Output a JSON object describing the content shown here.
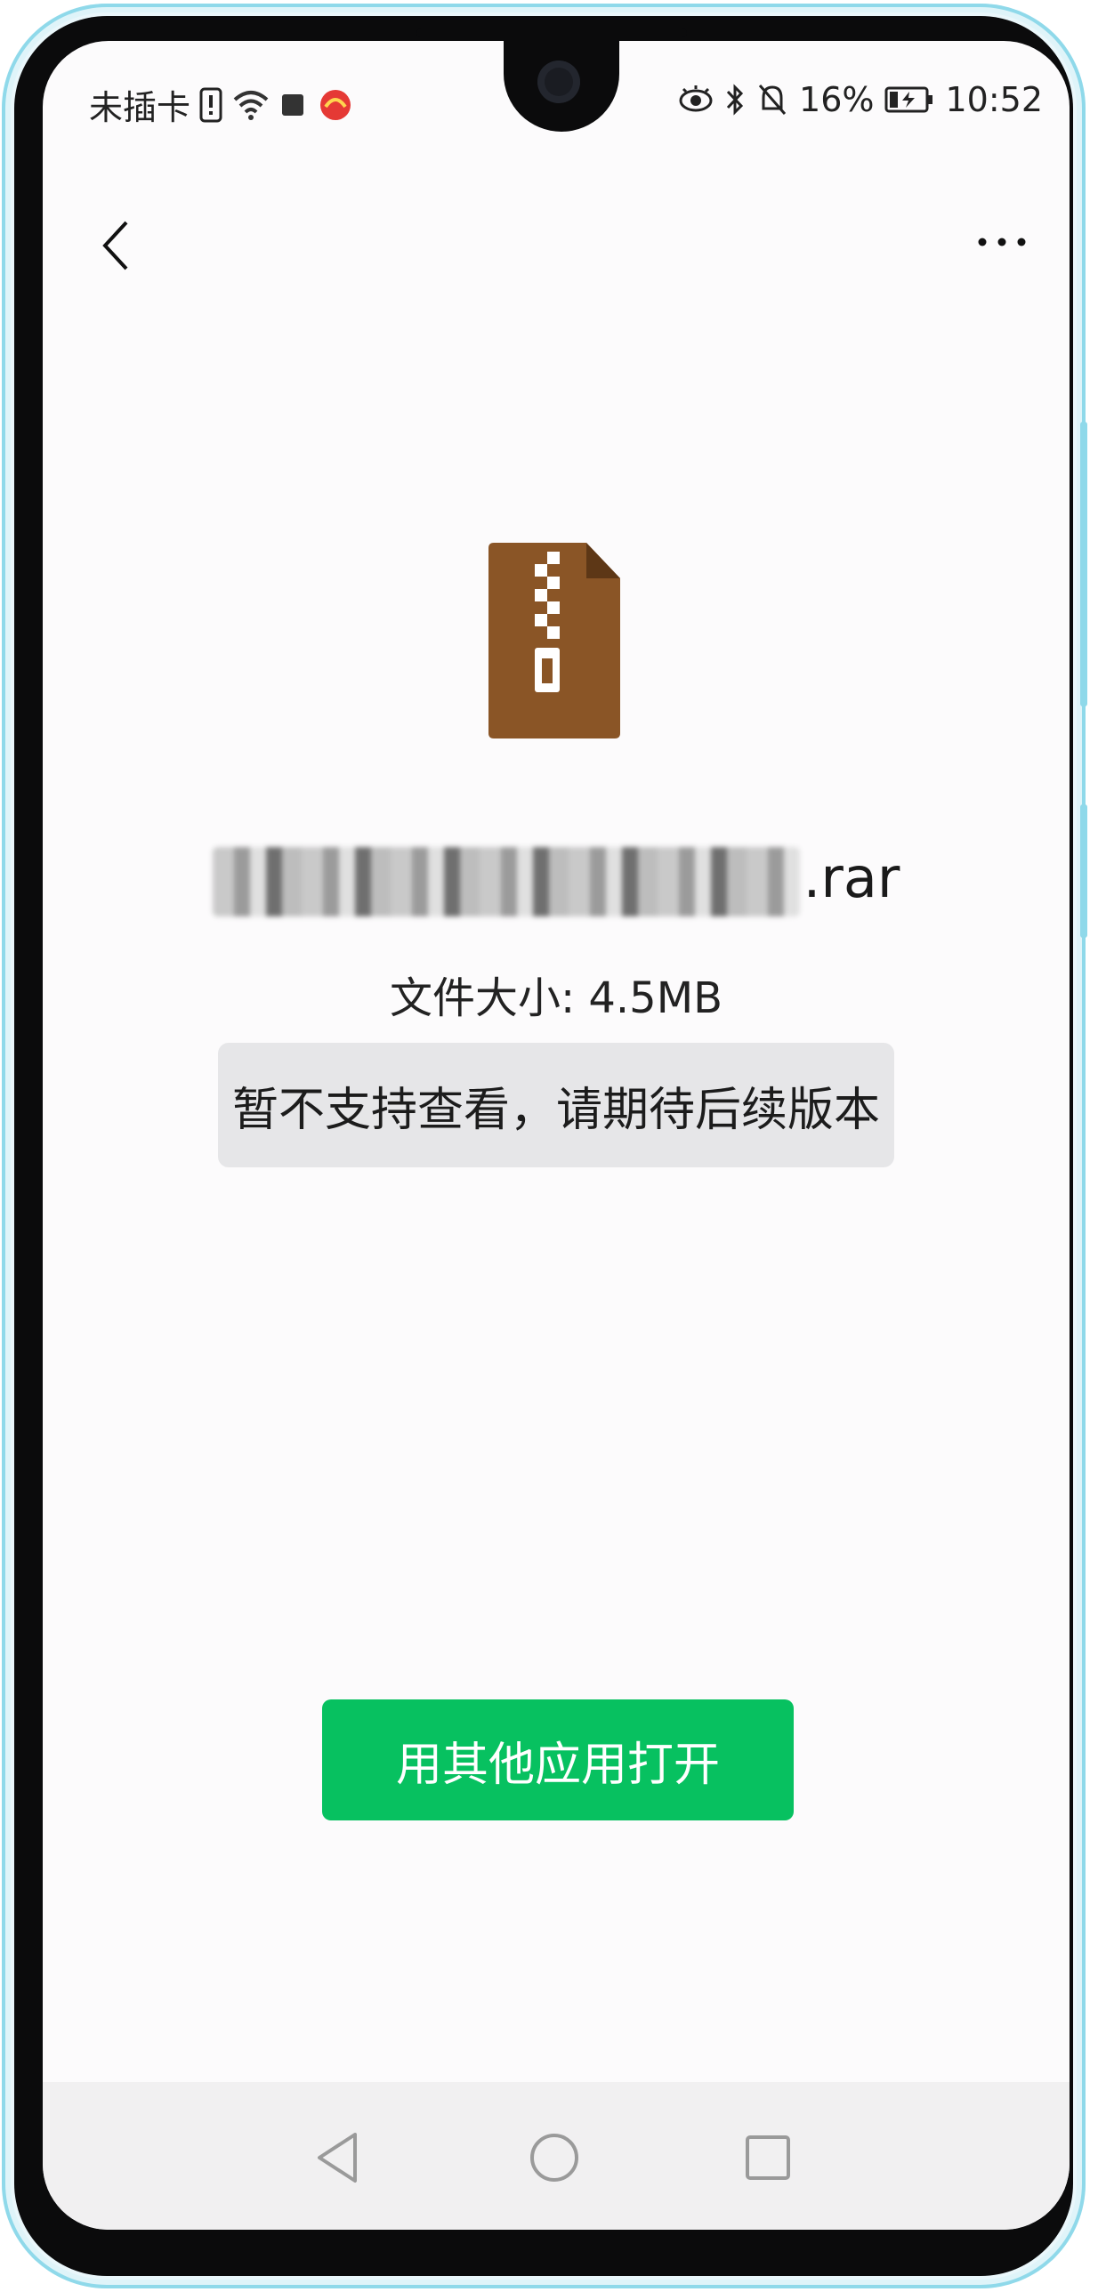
{
  "status_bar": {
    "carrier": "未插卡",
    "battery_percent": "16%",
    "time": "10:52"
  },
  "file": {
    "name_visible_suffix": ".rar",
    "size_text": "文件大小: 4.5MB"
  },
  "notice": {
    "text": "暂不支持查看，请期待后续版本"
  },
  "actions": {
    "open_with_other_app": "用其他应用打开"
  },
  "colors": {
    "primary_button": "#07c160",
    "archive_icon": "#8a5526",
    "notice_background": "#e6e6e8"
  },
  "icons": {
    "back": "chevron-left-icon",
    "more": "more-horizontal-icon",
    "file": "zip-archive-icon"
  }
}
